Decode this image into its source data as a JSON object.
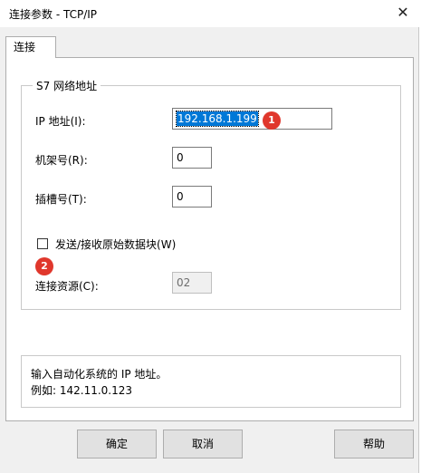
{
  "window": {
    "title": "连接参数 - TCP/IP",
    "close_glyph": "✕"
  },
  "tabs": [
    {
      "label": "连接",
      "active": true
    }
  ],
  "group": {
    "title": "S7 网络地址",
    "ip_label": "IP 地址(I):",
    "ip_value": "192.168.1.199",
    "rack_label": "机架号(R):",
    "rack_value": "0",
    "slot_label": "插槽号(T):",
    "slot_value": "0",
    "raw_block_label": "发送/接收原始数据块(W)",
    "raw_block_checked": false,
    "resource_label": "连接资源(C):",
    "resource_value": "02"
  },
  "markers": [
    "1",
    "2"
  ],
  "help": {
    "line1": "输入自动化系统的 IP 地址。",
    "line2": "例如: 142.11.0.123"
  },
  "buttons": {
    "ok": "确定",
    "cancel": "取消",
    "help": "帮助"
  },
  "colors": {
    "selection": "#0078d7",
    "marker": "#e0372c",
    "dialog_bg": "#f0f0f0"
  }
}
